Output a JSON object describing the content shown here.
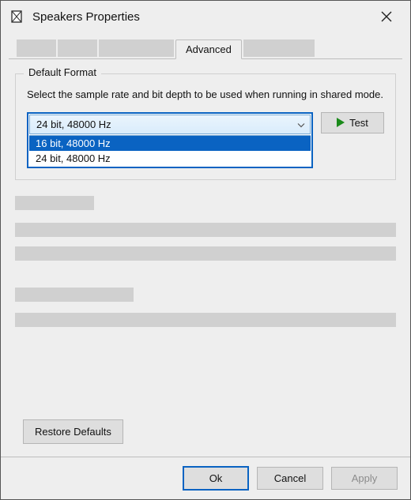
{
  "window": {
    "title": "Speakers Properties"
  },
  "tabs": {
    "active": "Advanced"
  },
  "default_format": {
    "legend": "Default Format",
    "description": "Select the sample rate and bit depth to be used when running in shared mode.",
    "selected": "24 bit, 48000 Hz",
    "options": [
      "16 bit, 48000 Hz",
      "24 bit, 48000 Hz"
    ],
    "test_label": "Test"
  },
  "buttons": {
    "restore_defaults": "Restore Defaults",
    "ok": "Ok",
    "cancel": "Cancel",
    "apply": "Apply"
  }
}
